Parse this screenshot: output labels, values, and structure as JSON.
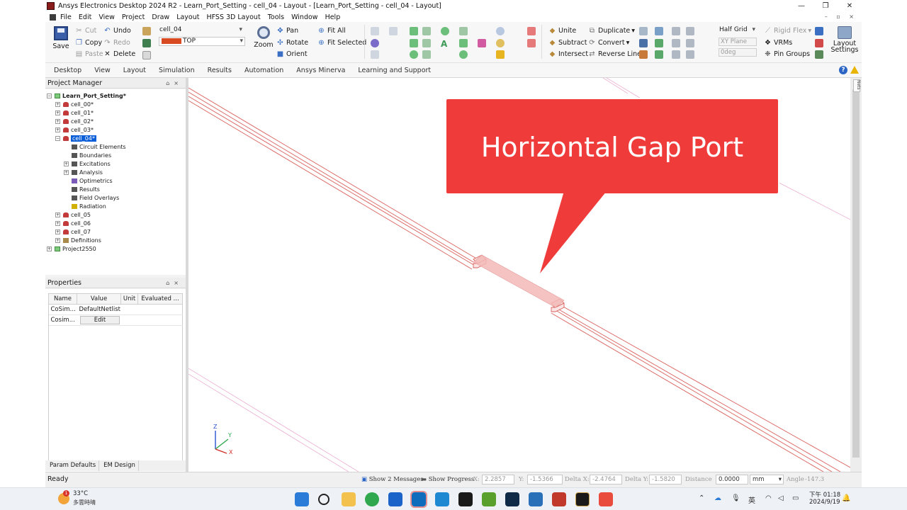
{
  "window": {
    "title": "Ansys Electronics Desktop 2024 R2 - Learn_Port_Setting - cell_04 - Layout - [Learn_Port_Setting - cell_04 - Layout]",
    "minimize": "—",
    "maximize": "❐",
    "close": "✕"
  },
  "menu": [
    "File",
    "Edit",
    "View",
    "Project",
    "Draw",
    "Layout",
    "HFSS 3D Layout",
    "Tools",
    "Window",
    "Help"
  ],
  "ribbon": {
    "save": "Save",
    "cut": "Cut",
    "copy": "Copy",
    "paste": "Paste",
    "undo": "Undo",
    "redo": "Redo",
    "delete": "Delete",
    "design_combo": "cell_04",
    "layer_combo": "TOP",
    "pan": "Pan",
    "rotate": "Rotate",
    "orient": "Orient",
    "zoom": "Zoom",
    "fit_all": "Fit All",
    "fit_selected": "Fit Selected",
    "unite": "Unite",
    "subtract": "Subtract",
    "intersect": "Intersect",
    "duplicate": "Duplicate",
    "convert": "Convert",
    "reverse_line": "Reverse Line",
    "grid_combo": "Half Grid",
    "plane_field": "XY Plane",
    "angle_field": "0deg",
    "rigid_flex": "Rigid Flex",
    "vrms": "VRMs",
    "pin_groups": "Pin Groups",
    "layout_settings_1": "Layout",
    "layout_settings_2": "Settings"
  },
  "tabs": [
    "Desktop",
    "View",
    "Layout",
    "Simulation",
    "Results",
    "Automation",
    "Ansys Minerva",
    "Learning and Support"
  ],
  "project_manager": {
    "title": "Project Manager",
    "tree": [
      {
        "label": "Learn_Port_Setting*",
        "indent": 0,
        "expander": "−",
        "icon": "project",
        "bold": true
      },
      {
        "label": "cell_00*",
        "indent": 1,
        "expander": "+",
        "icon": "design"
      },
      {
        "label": "cell_01*",
        "indent": 1,
        "expander": "+",
        "icon": "design"
      },
      {
        "label": "cell_02*",
        "indent": 1,
        "expander": "+",
        "icon": "design"
      },
      {
        "label": "cell_03*",
        "indent": 1,
        "expander": "+",
        "icon": "design"
      },
      {
        "label": "cell_04*",
        "indent": 1,
        "expander": "−",
        "icon": "design",
        "selected": true
      },
      {
        "label": "Circuit Elements",
        "indent": 2,
        "expander": "",
        "icon": "generic"
      },
      {
        "label": "Boundaries",
        "indent": 2,
        "expander": "",
        "icon": "generic"
      },
      {
        "label": "Excitations",
        "indent": 2,
        "expander": "+",
        "icon": "generic"
      },
      {
        "label": "Analysis",
        "indent": 2,
        "expander": "+",
        "icon": "generic"
      },
      {
        "label": "Optimetrics",
        "indent": 2,
        "expander": "",
        "icon": "opt"
      },
      {
        "label": "Results",
        "indent": 2,
        "expander": "",
        "icon": "generic"
      },
      {
        "label": "Field Overlays",
        "indent": 2,
        "expander": "",
        "icon": "generic"
      },
      {
        "label": "Radiation",
        "indent": 2,
        "expander": "",
        "icon": "star"
      },
      {
        "label": "cell_05",
        "indent": 1,
        "expander": "+",
        "icon": "design"
      },
      {
        "label": "cell_06",
        "indent": 1,
        "expander": "+",
        "icon": "design"
      },
      {
        "label": "cell_07",
        "indent": 1,
        "expander": "+",
        "icon": "design"
      },
      {
        "label": "Definitions",
        "indent": 1,
        "expander": "+",
        "icon": "folder"
      },
      {
        "label": "Project2550",
        "indent": 0,
        "expander": "+",
        "icon": "project"
      }
    ]
  },
  "properties": {
    "title": "Properties",
    "columns": [
      "Name",
      "Value",
      "Unit",
      "Evaluated ..."
    ],
    "rows": [
      {
        "name": "CoSim...",
        "value": "DefaultNetlist",
        "unit": "",
        "evaluated": ""
      },
      {
        "name": "Cosim...",
        "value": "Edit",
        "unit": "",
        "evaluated": ""
      }
    ],
    "tabs": [
      "Param Defaults",
      "EM Design"
    ]
  },
  "viewport": {
    "callout": "Horizontal Gap Port",
    "axis_z": "Z",
    "axis_y": "Y",
    "axis_x": "X",
    "nets_tab": "Nets"
  },
  "status": {
    "ready": "Ready",
    "messages": "Show 2 Messages",
    "progress": "Show Progress",
    "x_label": "X:",
    "x_value": "2.2857",
    "y_label": "Y:",
    "y_value": "-1.5366",
    "dx_label": "Delta X:",
    "dx_value": "-2.4764",
    "dy_label": "Delta Y:",
    "dy_value": "-1.5820",
    "distance_label": "Distance",
    "distance_value": "0.0000",
    "unit_value": "mm",
    "angle_label": "Angle",
    "angle_value": "-147.3"
  },
  "taskbar": {
    "weather_badge": "1",
    "weather_temp": "33°C",
    "weather_desc": "多雲時晴",
    "ime": "英",
    "time": "下午 01:18",
    "date": "2024/9/19"
  },
  "colors": {
    "trace_outline": "#d9605c",
    "port_fill": "#f2b9b7",
    "callout_bg": "#f03b3b",
    "callout_text": "#ffffff",
    "selection": "#0a5ed7",
    "layer_swatch": "#d84a22"
  }
}
